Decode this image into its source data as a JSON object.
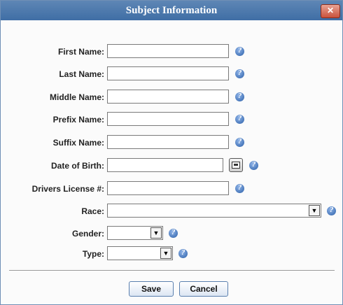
{
  "dialog": {
    "title": "Subject Information",
    "close_glyph": "✕"
  },
  "fields": {
    "first_name": {
      "label": "First Name:",
      "value": ""
    },
    "last_name": {
      "label": "Last Name:",
      "value": ""
    },
    "middle_name": {
      "label": "Middle Name:",
      "value": ""
    },
    "prefix_name": {
      "label": "Prefix Name:",
      "value": ""
    },
    "suffix_name": {
      "label": "Suffix Name:",
      "value": ""
    },
    "date_of_birth": {
      "label": "Date of Birth:",
      "value": ""
    },
    "drivers_license": {
      "label": "Drivers License #:",
      "value": ""
    },
    "race": {
      "label": "Race:",
      "value": ""
    },
    "gender": {
      "label": "Gender:",
      "value": ""
    },
    "type": {
      "label": "Type:",
      "value": ""
    }
  },
  "icons": {
    "help": "help-icon",
    "calendar": "calendar-icon",
    "dropdown": "chevron-down-icon",
    "help_glyph": "?",
    "dropdown_glyph": "▼"
  },
  "buttons": {
    "save_label": "Save",
    "cancel_label": "Cancel"
  },
  "colors": {
    "titlebar": "#4a78ad",
    "close_button": "#c9523c",
    "help_icon": "#2b5fa8"
  }
}
